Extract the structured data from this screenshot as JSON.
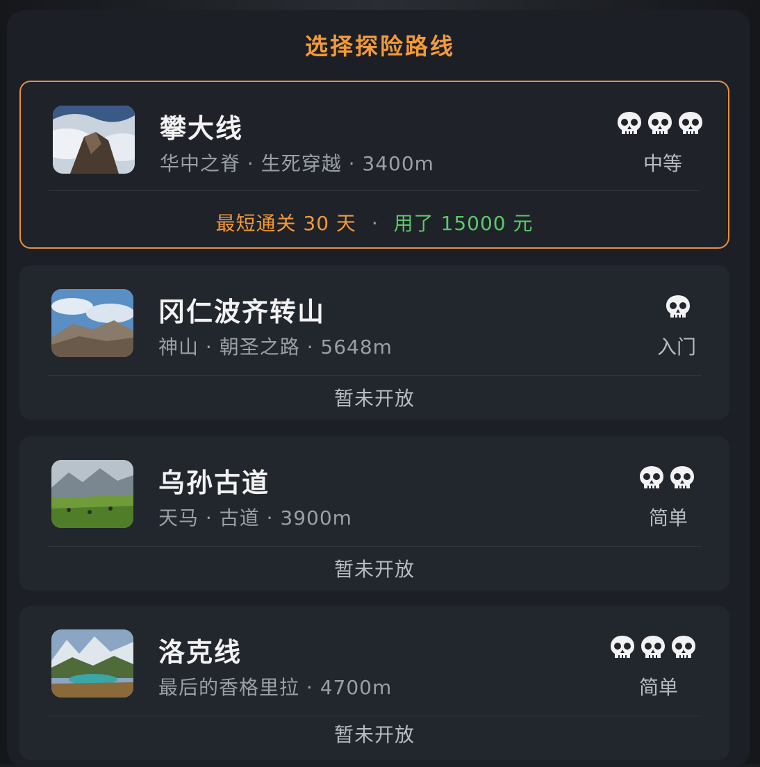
{
  "page": {
    "title": "选择探险路线"
  },
  "routes": [
    {
      "name": "攀大线",
      "subtitle": "华中之脊 · 生死穿越 · 3400m",
      "skulls": 3,
      "difficulty": "中等",
      "selected": true,
      "best_label": "最短通关 30 天",
      "separator": "·",
      "spent_label": "用了 15000 元"
    },
    {
      "name": "冈仁波齐转山",
      "subtitle": "神山 · 朝圣之路 · 5648m",
      "skulls": 1,
      "difficulty": "入门",
      "selected": false,
      "status": "暂未开放"
    },
    {
      "name": "乌孙古道",
      "subtitle": "天马 · 古道 · 3900m",
      "skulls": 2,
      "difficulty": "简单",
      "selected": false,
      "status": "暂未开放"
    },
    {
      "name": "洛克线",
      "subtitle": "最后的香格里拉 · 4700m",
      "skulls": 3,
      "difficulty": "简单",
      "selected": false,
      "status": "暂未开放"
    }
  ],
  "colors": {
    "accent": "#e8903a",
    "spent": "#5cc96a",
    "background": "#1c1f25"
  },
  "icons": {
    "difficulty": "skull-icon",
    "thumbnail": "landscape-thumbnail"
  }
}
